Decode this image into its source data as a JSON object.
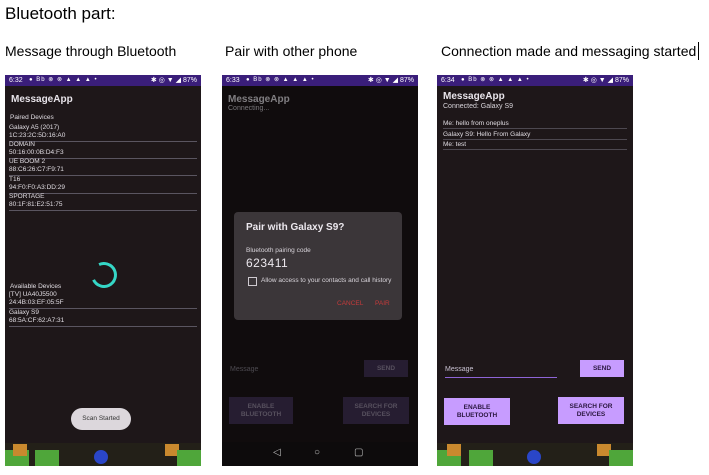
{
  "page": {
    "heading": "Bluetooth part:",
    "captions": [
      "Message through Bluetooth",
      "Pair with other phone",
      "Connection made and messaging started"
    ]
  },
  "phone1": {
    "time": "6:32",
    "status_icons": "● Bb ⊗ ⊗ ▲ ▲ ▲ •",
    "status_right": "✱ ◎ ▼ ◢ 87%",
    "app_title": "MessageApp",
    "paired_label": "Paired Devices",
    "paired_devices": [
      {
        "name": "Galaxy A5 (2017)",
        "mac": "1C:23:2C:5D:16:A0"
      },
      {
        "name": "DOMAIN",
        "mac": "50:16:00:0B:D4:F3"
      },
      {
        "name": "UE BOOM 2",
        "mac": "88:C6:26:C7:F9:71"
      },
      {
        "name": "T16",
        "mac": "94:F0:F0:A3:DD:29"
      },
      {
        "name": "SPORTAGE",
        "mac": "80:1F:81:E2:51:75"
      }
    ],
    "available_label": "Available Devices",
    "available_devices": [
      {
        "name": "[TV] UA40J5500",
        "mac": "24:4B:03:EF:05:5F"
      },
      {
        "name": "Galaxy S9",
        "mac": "68:5A:CF:62:A7:31"
      }
    ],
    "toast": "Scan Started"
  },
  "phone2": {
    "time": "6:33",
    "status_icons": "● Bb ⊗ ⊗ ▲ ▲ ▲ •",
    "status_right": "✱ ◎ ▼ ◢ 87%",
    "app_title": "MessageApp",
    "subtitle": "Connecting...",
    "dialog": {
      "title": "Pair with Galaxy S9?",
      "code_label": "Bluetooth pairing code",
      "code": "623411",
      "checkbox_label": "Allow access to your contacts and call history",
      "cancel": "CANCEL",
      "pair": "PAIR"
    },
    "message_placeholder": "Message",
    "send_label": "SEND",
    "enable_label": "ENABLE BLUETOOTH",
    "search_label": "SEARCH FOR DEVICES",
    "nav": {
      "back": "◁",
      "home": "○",
      "recent": "▢"
    }
  },
  "phone3": {
    "time": "6:34",
    "status_icons": "● Bb ⊗ ⊗ ▲ ▲ ▲ •",
    "status_right": "✱ ◎ ▼ ◢ 87%",
    "app_title": "MessageApp",
    "subtitle": "Connected: Galaxy S9",
    "messages": [
      "Me: hello from oneplus",
      "Galaxy S9: Hello From Galaxy",
      "Me: test"
    ],
    "message_placeholder": "Message",
    "send_label": "SEND",
    "enable_label": "ENABLE BLUETOOTH",
    "search_label": "SEARCH FOR DEVICES"
  },
  "colors": {
    "app_bg": "#1e1719",
    "status_bar": "#3a1e7a",
    "accent_button": "#c79cff",
    "dim_button": "#46355a",
    "spinner": "#35d6c6",
    "dialog_action": "#c43a3a"
  }
}
